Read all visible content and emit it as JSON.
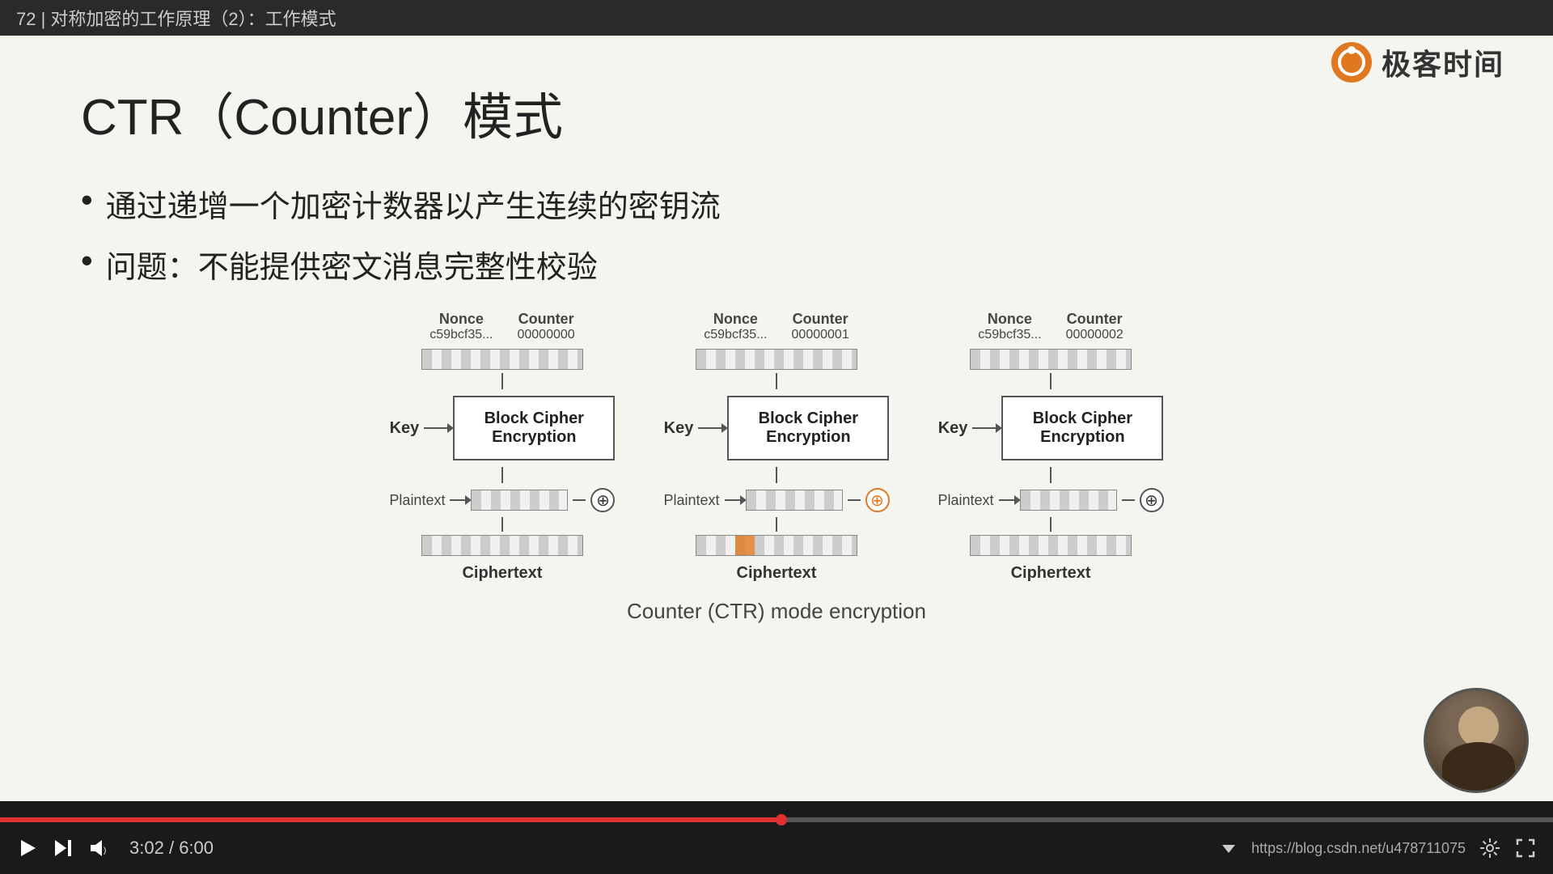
{
  "topbar": {
    "title": "72 | 对称加密的工作原理（2）：工作模式"
  },
  "logo": {
    "text": "极客时间",
    "icon_label": "geek-time-logo"
  },
  "slide": {
    "title": "CTR（Counter）模式",
    "bullets": [
      "通过递增一个加密计数器以产生连续的密钥流",
      "问题：不能提供密文消息完整性校验"
    ],
    "diagram": {
      "caption": "Counter (CTR) mode encryption",
      "blocks": [
        {
          "nonce_label": "Nonce",
          "nonce_value": "c59bcf35...",
          "counter_label": "Counter",
          "counter_value": "00000000",
          "cipher_label": "Block Cipher\nEncryption",
          "key_label": "Key",
          "plaintext_label": "Plaintext",
          "ciphertext_label": "Ciphertext",
          "highlight": false
        },
        {
          "nonce_label": "Nonce",
          "nonce_value": "c59bcf35...",
          "counter_label": "Counter",
          "counter_value": "00000001",
          "cipher_label": "Block Cipher\nEncryption",
          "key_label": "Key",
          "plaintext_label": "Plaintext",
          "ciphertext_label": "Ciphertext",
          "highlight": true
        },
        {
          "nonce_label": "Nonce",
          "nonce_value": "c59bcf35...",
          "counter_label": "Counter",
          "counter_value": "00000002",
          "cipher_label": "Block Cipher\nEncryption",
          "key_label": "Key",
          "plaintext_label": "Plaintext",
          "ciphertext_label": "Ciphertext",
          "highlight": false
        }
      ]
    }
  },
  "controls": {
    "time_current": "3:02",
    "time_total": "6:00",
    "url": "https://blog.csdn.net/u478711075",
    "progress_percent": 50.3
  }
}
